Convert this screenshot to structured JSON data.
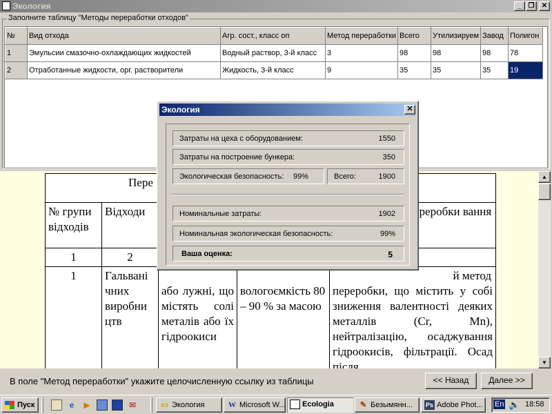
{
  "window": {
    "title": "Экология",
    "min": "_",
    "max": "❐",
    "close": "✕"
  },
  "group_label": "Заполните таблицу \"Методы переработки отходов\"",
  "grid": {
    "headers": [
      "№",
      "Вид отхода",
      "Агр. сост., класс оп",
      "Метод переработки",
      "Всего",
      "Утилизируем",
      "Завод",
      "Полигон"
    ],
    "rows": [
      [
        "1",
        "Эмульсии смазочно-охлаждающих жидкостей",
        "Водный раствор, 3-й класс",
        "3",
        "98",
        "98",
        "98",
        "78"
      ],
      [
        "2",
        "Отработанные жидкости, орг. растворители",
        "Жидкость, 3-й класс",
        "9",
        "35",
        "35",
        "35",
        "19"
      ]
    ]
  },
  "document": {
    "title_fragment": "Пере",
    "col1": "№ групи відходів",
    "col2": "Відходи",
    "col5": "ереробки вання",
    "nums": [
      "1",
      "2"
    ],
    "row_num": "1",
    "row_waste": "Гальвані чних виробни цтв",
    "row_c3": "або лужні, що містять солі металів або їх гідроокиси",
    "row_c4": "вологоємкість 80 – 90 % за масою",
    "row_c5a": "й метод",
    "row_c5": "переробки, що містить у собі зниження валентності деяких металлів (Cr, Mn), нейтралізацію, осаджування гідроокисів, фільтрації. Осад після"
  },
  "status": {
    "text": "В поле \"Метод переработки\" укажите целочисленную ссылку из таблицы",
    "back_label": "<< Назад",
    "next_label": "Далее >>"
  },
  "modal": {
    "title": "Экология",
    "close": "✕",
    "rows": {
      "equipment_label": "Затраты на цеха с оборудованием:",
      "equipment_value": "1550",
      "bunker_label": "Затраты на построение бункера:",
      "bunker_value": "350",
      "safety_label": "Экологическая безопасность:",
      "safety_value": "99%",
      "total_label": "Всего:",
      "total_value": "1900",
      "nominal_cost_label": "Номинальные затраты:",
      "nominal_cost_value": "1902",
      "nominal_safety_label": "Номинальная экологическая безопасность:",
      "nominal_safety_value": "99%",
      "score_label": "Ваша оценка:",
      "score_value": "5"
    }
  },
  "taskbar": {
    "start_label": "Пуск",
    "tasks": [
      {
        "label": "Экология",
        "icon": "folder-icon"
      },
      {
        "label": "Microsoft W...",
        "icon": "word-icon"
      },
      {
        "label": "Ecologia",
        "icon": "app-icon",
        "active": true
      },
      {
        "label": "Безымянн...",
        "icon": "paint-icon"
      },
      {
        "label": "Adobe Phot...",
        "icon": "photoshop-icon"
      }
    ],
    "lang": "En",
    "clock": "18:58"
  },
  "colors": {
    "titlebar_inactive": "#808080",
    "modal_titlebar": "#0a246a",
    "selection": "#0a246a",
    "doc_background": "#ffffe1"
  }
}
